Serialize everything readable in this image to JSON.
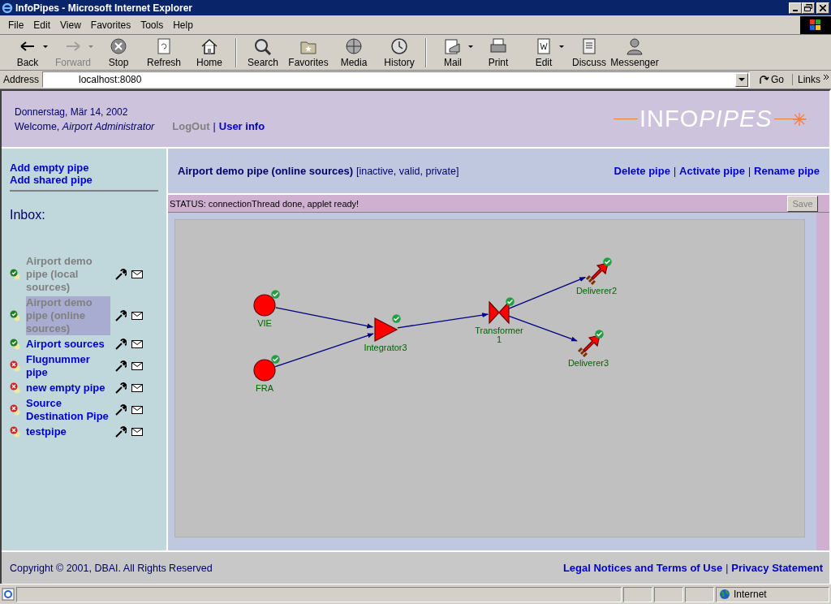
{
  "window": {
    "title": "InfoPipes - Microsoft Internet Explorer"
  },
  "menu": [
    "File",
    "Edit",
    "View",
    "Favorites",
    "Tools",
    "Help"
  ],
  "toolbar": [
    {
      "kind": "back",
      "label": "Back",
      "disabled": false,
      "dropdown": true
    },
    {
      "kind": "forward",
      "label": "Forward",
      "disabled": true,
      "dropdown": true
    },
    {
      "kind": "stop",
      "label": "Stop",
      "disabled": false,
      "dropdown": false
    },
    {
      "kind": "refresh",
      "label": "Refresh",
      "disabled": false,
      "dropdown": false
    },
    {
      "kind": "home",
      "label": "Home",
      "disabled": false,
      "dropdown": false,
      "sep_after": true
    },
    {
      "kind": "search",
      "label": "Search",
      "disabled": false,
      "dropdown": false
    },
    {
      "kind": "favorites",
      "label": "Favorites",
      "disabled": false,
      "dropdown": false
    },
    {
      "kind": "media",
      "label": "Media",
      "disabled": false,
      "dropdown": false
    },
    {
      "kind": "history",
      "label": "History",
      "disabled": false,
      "dropdown": false,
      "sep_after": true
    },
    {
      "kind": "mail",
      "label": "Mail",
      "disabled": false,
      "dropdown": true
    },
    {
      "kind": "print",
      "label": "Print",
      "disabled": false,
      "dropdown": false
    },
    {
      "kind": "edit",
      "label": "Edit",
      "disabled": false,
      "dropdown": true
    },
    {
      "kind": "discuss",
      "label": "Discuss",
      "disabled": false,
      "dropdown": false
    },
    {
      "kind": "messenger",
      "label": "Messenger",
      "disabled": false,
      "dropdown": false
    }
  ],
  "address": {
    "label": "Address",
    "value": "localhost:8080",
    "go": "Go",
    "links": "Links"
  },
  "header": {
    "date": "Donnerstag, Mär 14, 2002",
    "welcome": "Welcome, *Airport Administrator*",
    "logout": "LogOut",
    "separator": "|",
    "user_info": "User info",
    "logo": "INFO",
    "logo_italic": "PIPES"
  },
  "sidebar": {
    "actions": [
      "Add empty pipe",
      "Add shared pipe"
    ],
    "inbox_title": "Inbox:",
    "items": [
      {
        "label": "Airport demo pipe (local sources)",
        "valid": true,
        "greyed": true,
        "selected": false
      },
      {
        "label": "Airport demo pipe (online sources)",
        "valid": true,
        "greyed": true,
        "selected": true
      },
      {
        "label": "Airport sources",
        "valid": true,
        "greyed": false,
        "selected": false
      },
      {
        "label": "Flugnummer pipe",
        "valid": false,
        "greyed": false,
        "selected": false
      },
      {
        "label": "new empty pipe",
        "valid": false,
        "greyed": false,
        "selected": false
      },
      {
        "label": "Source Destination Pipe",
        "valid": false,
        "greyed": false,
        "selected": false
      },
      {
        "label": "testpipe",
        "valid": false,
        "greyed": false,
        "selected": false
      }
    ]
  },
  "pipe": {
    "title": "Airport demo pipe (online sources)",
    "flags": "[inactive, valid, private]",
    "separator": "|",
    "actions": [
      "Delete pipe",
      "Activate pipe",
      "Rename pipe"
    ]
  },
  "status": {
    "text": "STATUS: connectionThread done, applet ready!",
    "save": "Save",
    "save_disabled": true
  },
  "diagram": {
    "nodes": [
      {
        "kind": "source",
        "label": "VIE",
        "ok": true
      },
      {
        "kind": "source",
        "label": "FRA",
        "ok": true
      },
      {
        "kind": "integrator",
        "label": "Integrator3",
        "ok": true
      },
      {
        "kind": "transformer",
        "label": "Transformer 1",
        "ok": true
      },
      {
        "kind": "deliverer",
        "label": "Deliverer2",
        "ok": true
      },
      {
        "kind": "deliverer",
        "label": "Deliverer3",
        "ok": true
      }
    ]
  },
  "footer": {
    "copyright": "Copyright © 2001, DBAI. All Rights Reserved",
    "separator": "|",
    "links": [
      "Legal Notices and Terms of Use",
      "Privacy Statement"
    ]
  },
  "status_bar": {
    "zone": "Internet"
  }
}
